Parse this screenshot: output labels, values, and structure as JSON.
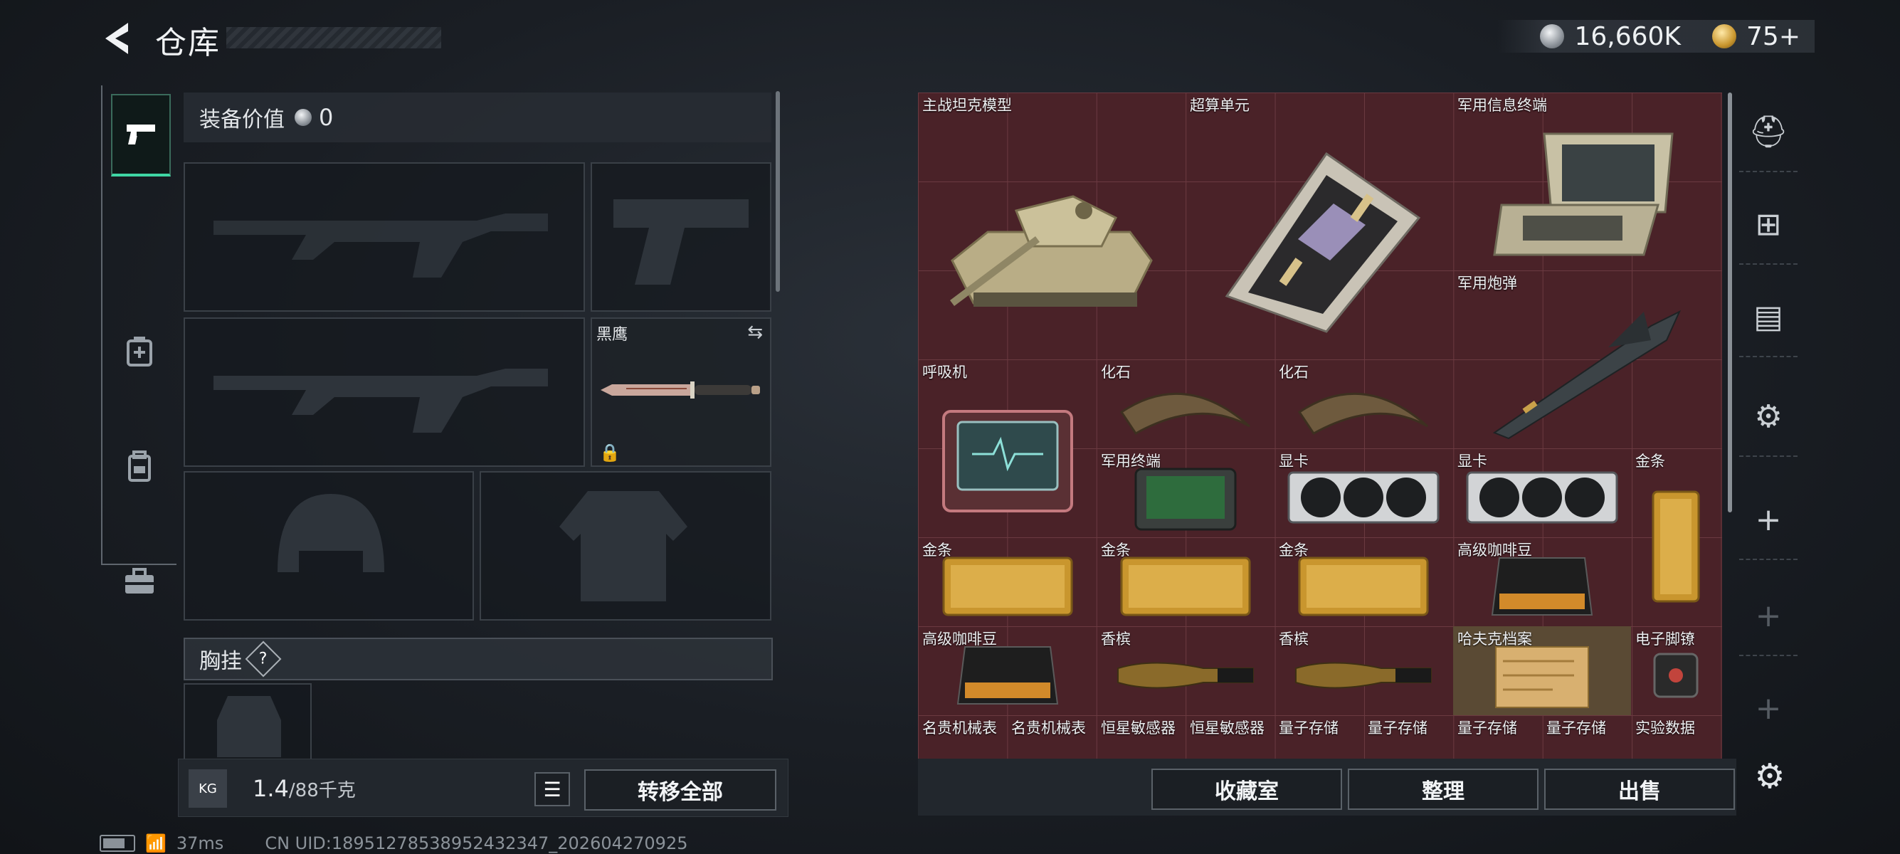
{
  "header": {
    "title": "仓库",
    "silver": "16,660K",
    "gold": "75+"
  },
  "left_tabs": [
    {
      "icon": "pistol-icon"
    },
    {
      "icon": "medkit-icon"
    },
    {
      "icon": "backpack-icon"
    },
    {
      "icon": "toolbox-icon"
    }
  ],
  "equipment": {
    "value_label": "装备价值",
    "value": "0",
    "knife_name": "黑鹰",
    "chest_label": "胸挂",
    "chest_help": "?"
  },
  "weight": {
    "current": "1.4",
    "max": "/88千克",
    "icon": "KG"
  },
  "buttons": {
    "transfer_all": "转移全部",
    "collection": "收藏室",
    "organize": "整理",
    "sell": "出售"
  },
  "stash_items": [
    {
      "name": "主战坦克模型",
      "icon": "tank-model"
    },
    {
      "name": "超算单元",
      "icon": "supercomputer-unit"
    },
    {
      "name": "军用信息终端",
      "icon": "military-terminal"
    },
    {
      "name": "军用炮弹",
      "icon": "artillery-shell"
    },
    {
      "name": "呼吸机",
      "icon": "ventilator"
    },
    {
      "name": "化石",
      "icon": "fossil-claw"
    },
    {
      "name": "化石",
      "icon": "fossil-claw"
    },
    {
      "name": "军用终端",
      "icon": "military-terminal-small"
    },
    {
      "name": "显卡",
      "icon": "graphics-card"
    },
    {
      "name": "显卡",
      "icon": "graphics-card"
    },
    {
      "name": "金条",
      "icon": "gold-bar"
    },
    {
      "name": "金条",
      "icon": "gold-bar"
    },
    {
      "name": "金条",
      "icon": "gold-bar"
    },
    {
      "name": "金条",
      "icon": "gold-bar"
    },
    {
      "name": "高级咖啡豆",
      "icon": "coffee-bag"
    },
    {
      "name": "高级咖啡豆",
      "icon": "coffee-bag"
    },
    {
      "name": "香槟",
      "icon": "champagne"
    },
    {
      "name": "香槟",
      "icon": "champagne"
    },
    {
      "name": "哈夫克档案",
      "icon": "archive-folder"
    },
    {
      "name": "电子脚镣",
      "icon": "ankle-monitor"
    },
    {
      "name": "名贵机械表",
      "icon": "watch"
    },
    {
      "name": "名贵机械表",
      "icon": "watch"
    },
    {
      "name": "恒星敏感器",
      "icon": "star-sensor"
    },
    {
      "name": "恒星敏感器",
      "icon": "star-sensor"
    },
    {
      "name": "量子存储",
      "icon": "quantum-storage"
    },
    {
      "name": "量子存储",
      "icon": "quantum-storage"
    },
    {
      "name": "量子存储",
      "icon": "quantum-storage"
    },
    {
      "name": "量子存储",
      "icon": "quantum-storage"
    },
    {
      "name": "实验数据",
      "icon": "experiment-data"
    }
  ],
  "side_icons": [
    "helmet-icon",
    "add-level-icon",
    "folder-icon",
    "vehicle-icon",
    "plus-icon",
    "plus-icon",
    "plus-icon"
  ],
  "status": {
    "ping": "37ms",
    "uid": "CN UID:1895127853895243234​7_202604270925"
  },
  "colors": {
    "accent": "#3fd6a4",
    "stash_bg": "#4a2228",
    "grid_line": "#6b3a41",
    "gold": "#c9962e"
  }
}
